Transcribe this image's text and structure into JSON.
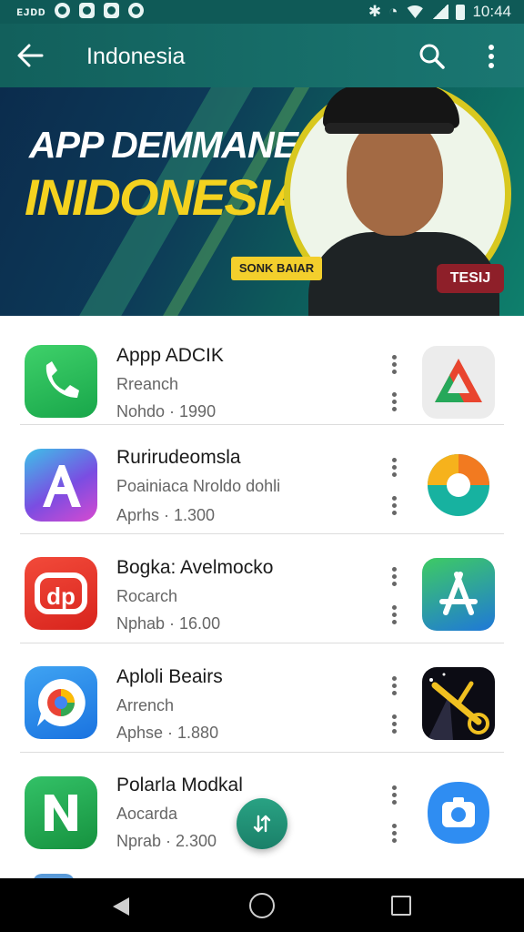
{
  "status_bar": {
    "carrier": "ᴇᴊᴅᴅ",
    "time": "10:44",
    "icons": [
      "camera-icon",
      "image-icon",
      "shield-icon",
      "record-icon",
      "bluetooth-icon",
      "alarm-icon",
      "wifi-icon",
      "signal-icon",
      "battery-icon"
    ]
  },
  "app_bar": {
    "title": "Indonesia",
    "icons": [
      "arrow-back-icon",
      "search-icon",
      "more-vert-icon"
    ]
  },
  "banner": {
    "line1": "APP DEMMANE",
    "line2": "INIDONESIA",
    "badge_left": "SONK BAIAR",
    "badge_right": "TESIJ",
    "dots_count": 3,
    "active_dot": 1,
    "colors": {
      "headline_yellow": "#f4d21f",
      "badge_red": "#8e1f29"
    }
  },
  "apps": [
    {
      "name": "Appp ADCIK",
      "subtitle": "Rreanch",
      "meta": "Nohdo · 1990",
      "icon": "phone-icon",
      "right_icon": "delta-logo-icon"
    },
    {
      "name": "Rurirudeomsla",
      "subtitle": "Poainiaca Nroldo dohli",
      "meta": "Aprhs · 1.300",
      "icon": "letter-a-icon",
      "right_icon": "swirl-logo-icon"
    },
    {
      "name": "Bogka: Avelmocko",
      "subtitle": "Rocarch",
      "meta": "Nphab · 16.00",
      "icon": "chat-logo-icon",
      "right_icon": "app-store-icon"
    },
    {
      "name": "Aploli Beairs",
      "subtitle": "Arrench",
      "meta": "Aphse · 1.880",
      "icon": "chrome-chat-icon",
      "right_icon": "bike-game-icon"
    },
    {
      "name": "Polarla Modkal",
      "subtitle": "Aocarda",
      "meta": "Nprab · 2.300",
      "icon": "letter-n-icon",
      "right_icon": "camera-app-icon"
    }
  ],
  "fab": {
    "icon": "swap-icon"
  },
  "nav": {
    "icons": [
      "nav-back-icon",
      "nav-home-icon",
      "nav-recents-icon"
    ]
  }
}
